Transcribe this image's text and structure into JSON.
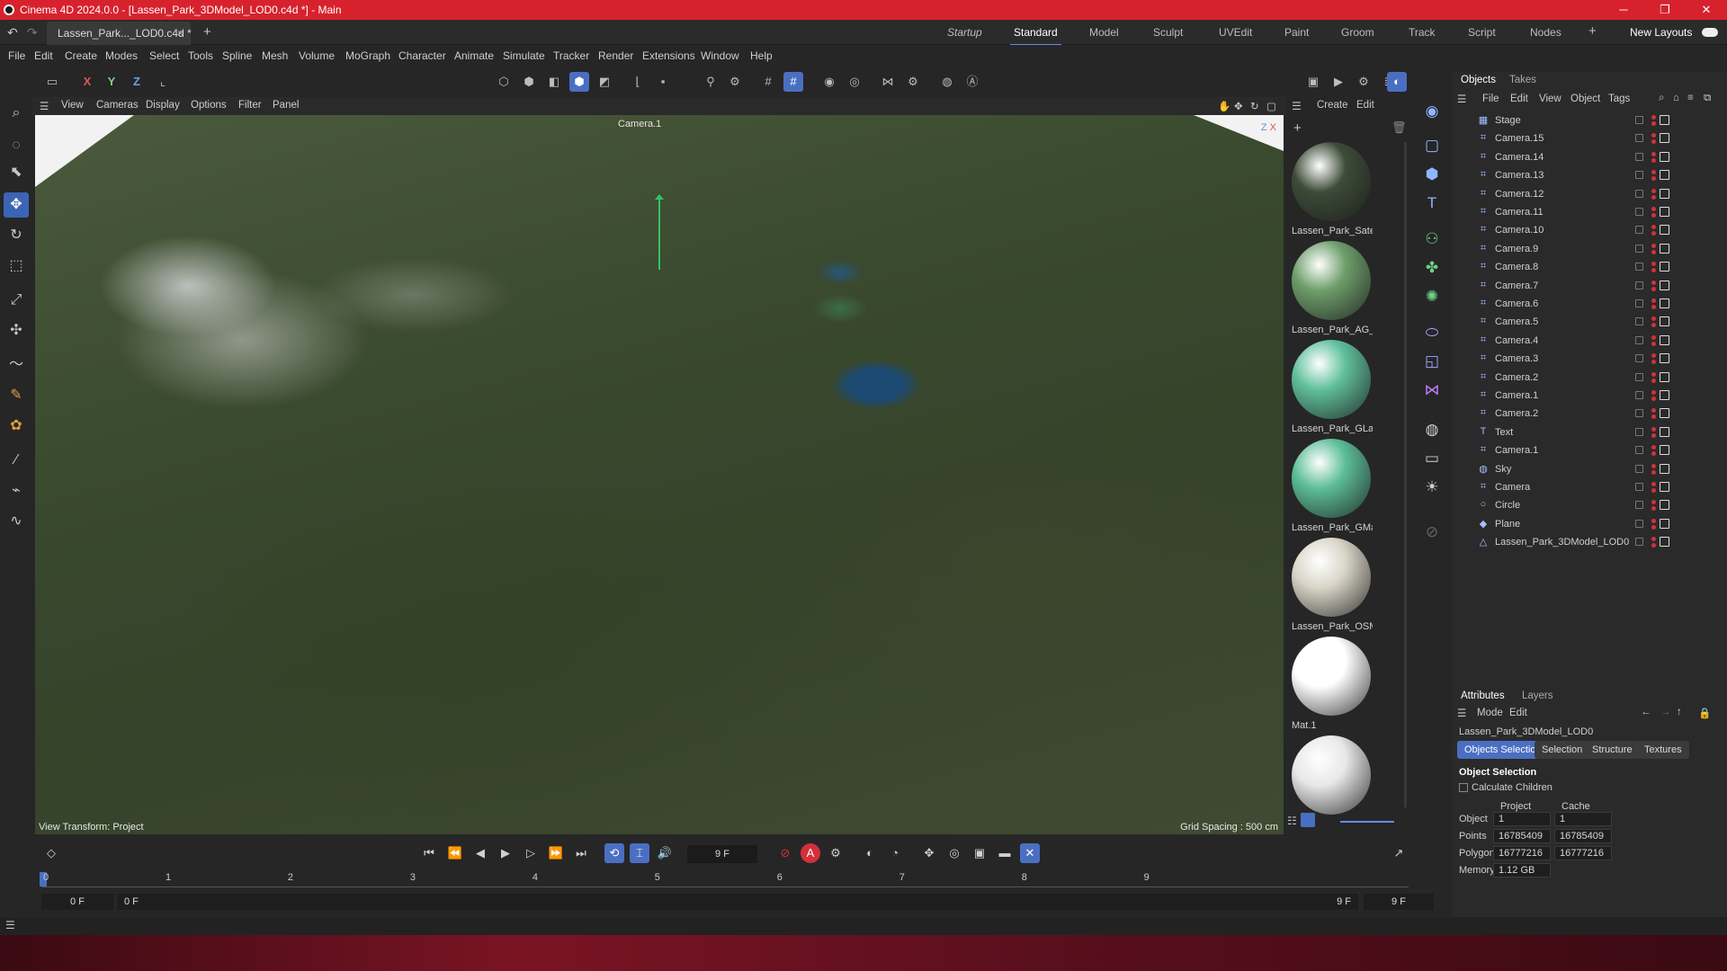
{
  "window": {
    "title": "Cinema 4D 2024.0.0 - [Lassen_Park_3DModel_LOD0.c4d *] - Main",
    "controls": [
      "─",
      "❐",
      "✕"
    ]
  },
  "doc_tab": {
    "label": "Lassen_Park..._LOD0.c4d *",
    "close": "×",
    "add": "+"
  },
  "layouts": {
    "items": [
      "Startup",
      "Standard",
      "Model",
      "Sculpt",
      "UVEdit",
      "Paint",
      "Groom",
      "Track",
      "Script",
      "Nodes"
    ],
    "active": "Standard",
    "plus": "+",
    "new_layouts": "New Layouts"
  },
  "menu": [
    "File",
    "Edit",
    "Create",
    "Modes",
    "Select",
    "Tools",
    "Spline",
    "Mesh",
    "Volume",
    "MoGraph",
    "Character",
    "Animate",
    "Simulate",
    "Tracker",
    "Render",
    "Extensions",
    "Window",
    "Help"
  ],
  "axis_lock": {
    "x": "X",
    "y": "Y",
    "z": "Z"
  },
  "viewport_menu": [
    "View",
    "Cameras",
    "Display",
    "Options",
    "Filter",
    "Panel"
  ],
  "viewport": {
    "camera_label": "Camera.1",
    "view_transform": "View Transform: Project",
    "grid_spacing": "Grid Spacing : 500 cm",
    "gizmo_z": "Z",
    "gizmo_x": "X"
  },
  "material_panel": {
    "menu": [
      "Create",
      "Edit"
    ],
    "materials": [
      {
        "name": "Lassen_Park_Satel",
        "color": "#3d4b38"
      },
      {
        "name": "Lassen_Park_AG_L",
        "color": "#6d9e6a"
      },
      {
        "name": "Lassen_Park_GLan",
        "color": "#5fbf9c"
      },
      {
        "name": "Lassen_Park_GMa",
        "color": "#5cbd98"
      },
      {
        "name": "Lassen_Park_OSM",
        "color": "#d9d6c8"
      },
      {
        "name": "Mat.1",
        "color": "#ffffff"
      },
      {
        "name": "",
        "color": "#e8e8e8"
      }
    ]
  },
  "objects_panel": {
    "tabs": [
      "Objects",
      "Takes"
    ],
    "active_tab": "Objects",
    "menu": [
      "File",
      "Edit",
      "View",
      "Object",
      "Tags"
    ],
    "objects": [
      {
        "name": "Stage",
        "icon": "stage-icon"
      },
      {
        "name": "Camera.15",
        "icon": "camera-icon"
      },
      {
        "name": "Camera.14",
        "icon": "camera-icon"
      },
      {
        "name": "Camera.13",
        "icon": "camera-icon"
      },
      {
        "name": "Camera.12",
        "icon": "camera-icon"
      },
      {
        "name": "Camera.11",
        "icon": "camera-icon"
      },
      {
        "name": "Camera.10",
        "icon": "camera-icon"
      },
      {
        "name": "Camera.9",
        "icon": "camera-icon"
      },
      {
        "name": "Camera.8",
        "icon": "camera-icon"
      },
      {
        "name": "Camera.7",
        "icon": "camera-icon"
      },
      {
        "name": "Camera.6",
        "icon": "camera-icon"
      },
      {
        "name": "Camera.5",
        "icon": "camera-icon"
      },
      {
        "name": "Camera.4",
        "icon": "camera-icon"
      },
      {
        "name": "Camera.3",
        "icon": "camera-icon"
      },
      {
        "name": "Camera.2",
        "icon": "camera-icon"
      },
      {
        "name": "Camera.1",
        "icon": "camera-icon"
      },
      {
        "name": "Camera.2",
        "icon": "camera-icon"
      },
      {
        "name": "Text",
        "icon": "text-icon"
      },
      {
        "name": "Camera.1",
        "icon": "camera-icon"
      },
      {
        "name": "Sky",
        "icon": "sky-icon"
      },
      {
        "name": "Camera",
        "icon": "camera-icon"
      },
      {
        "name": "Circle",
        "icon": "circle-icon"
      },
      {
        "name": "Plane",
        "icon": "plane-icon"
      },
      {
        "name": "Lassen_Park_3DModel_LOD0",
        "icon": "polygon-object-icon"
      }
    ]
  },
  "attributes": {
    "tabs": [
      "Attributes",
      "Layers"
    ],
    "active_tab": "Attributes",
    "menu": [
      "Mode",
      "Edit"
    ],
    "object_name": "Lassen_Park_3DModel_LOD0",
    "subtabs": [
      "Objects Selection",
      "Selection",
      "Structure",
      "Textures"
    ],
    "active_subtab": "Objects Selection",
    "section_title": "Object Selection",
    "calculate_children": "Calculate Children",
    "columns": [
      "Project",
      "Cache"
    ],
    "rows": [
      {
        "label": "Object",
        "project": "1",
        "cache": "1"
      },
      {
        "label": "Points",
        "project": "16785409",
        "cache": "16785409"
      },
      {
        "label": "Polygons",
        "project": "16777216",
        "cache": "16777216"
      },
      {
        "label": "Memory",
        "project": "1.12 GB",
        "cache": ""
      }
    ]
  },
  "timeline": {
    "current_frame": "9 F",
    "ruler": [
      "0",
      "1",
      "2",
      "3",
      "4",
      "5",
      "6",
      "7",
      "8",
      "9"
    ],
    "start_field": "0 F",
    "range_start": "0 F",
    "range_end": "9 F",
    "end_field": "9 F",
    "progress": 0.0
  },
  "colors": {
    "title_bar": "#d7222e",
    "accent": "#4a6fc2",
    "record_red": "#d2303b",
    "axis_green": "#37c06a"
  }
}
